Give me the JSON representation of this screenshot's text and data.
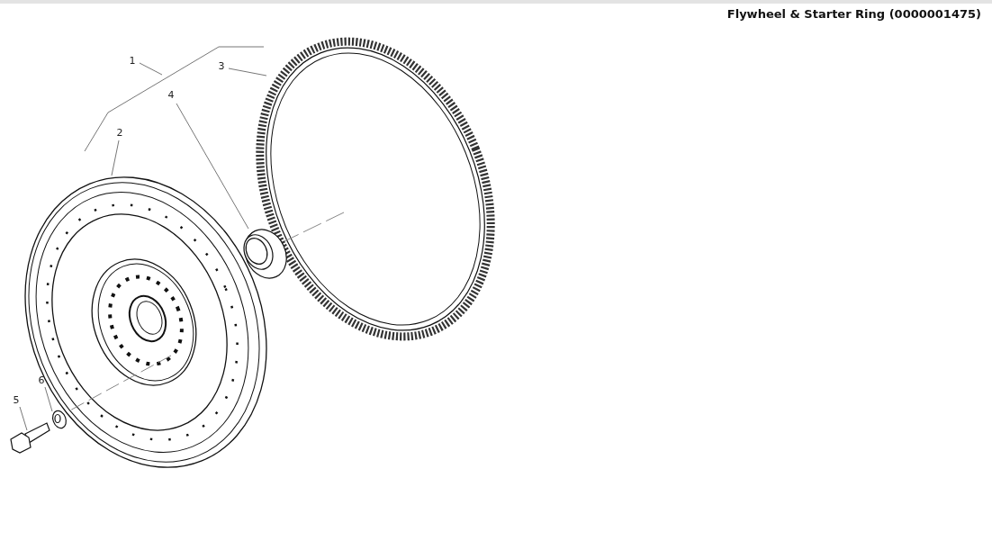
{
  "title": "Flywheel & Starter Ring (0000001475)",
  "diagram": {
    "callouts": [
      "1",
      "2",
      "3",
      "4",
      "5",
      "6"
    ]
  }
}
